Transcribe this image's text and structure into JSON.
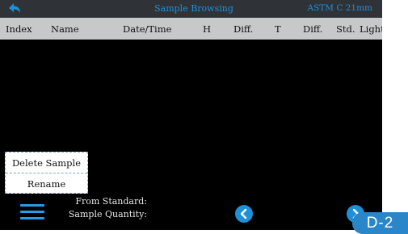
{
  "titlebar": {
    "back_icon": "back-arrow-icon",
    "title": "Sample Browsing",
    "standard": "ASTM C 21mm"
  },
  "table": {
    "columns": [
      "Index",
      "Name",
      "Date/Time",
      "H",
      "Diff.",
      "T",
      "Diff.",
      "Std.",
      "Light"
    ],
    "rows": []
  },
  "context_menu": {
    "items": [
      "Delete Sample",
      "Rename"
    ]
  },
  "footer": {
    "menu_icon": "hamburger-menu-icon",
    "from_standard_label": "From Standard:",
    "sample_quantity_label": "Sample Quantity:",
    "prev_icon": "chevron-left-icon",
    "next_icon": "chevron-right-icon"
  },
  "badge": "D-2",
  "colors": {
    "accent": "#1f8fd8",
    "titlebar_bg": "#2f3338",
    "header_bg": "#c6c8ca",
    "screen_bg": "#000000",
    "badge_bg": "#2b86c9"
  }
}
